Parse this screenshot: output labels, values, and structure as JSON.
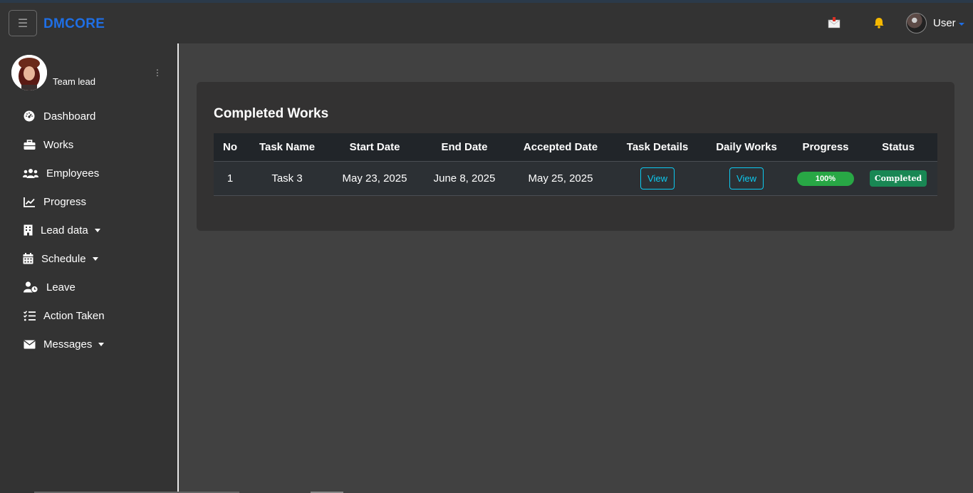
{
  "navbar": {
    "brand": "DMCORE",
    "toggler_icon": "hamburger-icon",
    "icons": [
      "mail-icon",
      "bell-icon"
    ],
    "user_label": "User",
    "accent": "#1f6fe5"
  },
  "sidebar": {
    "profile_role": "Team lead",
    "items": [
      {
        "label": "Dashboard",
        "icon": "gauge-icon",
        "dropdown": false
      },
      {
        "label": "Works",
        "icon": "briefcase-icon",
        "dropdown": false
      },
      {
        "label": "Employees",
        "icon": "users-icon",
        "dropdown": false
      },
      {
        "label": "Progress",
        "icon": "line-chart-icon",
        "dropdown": false
      },
      {
        "label": "Lead data",
        "icon": "building-icon",
        "dropdown": true
      },
      {
        "label": "Schedule",
        "icon": "calendar-icon",
        "dropdown": true
      },
      {
        "label": "Leave",
        "icon": "user-clock-icon",
        "dropdown": false
      },
      {
        "label": "Action Taken",
        "icon": "list-check-icon",
        "dropdown": false
      },
      {
        "label": "Messages",
        "icon": "envelope-icon",
        "dropdown": true
      }
    ]
  },
  "card": {
    "title": "Completed Works",
    "columns": [
      "No",
      "Task Name",
      "Start Date",
      "End Date",
      "Accepted Date",
      "Task Details",
      "Daily Works",
      "Progress",
      "Status"
    ],
    "rows": [
      {
        "no": "1",
        "task_name": "Task 3",
        "start_date": "May 23, 2025",
        "end_date": "June 8, 2025",
        "accepted_date": "May 25, 2025",
        "task_details": "View",
        "daily_works": "View",
        "progress": "100%",
        "progress_value": 100,
        "status": "Completed"
      }
    ]
  }
}
